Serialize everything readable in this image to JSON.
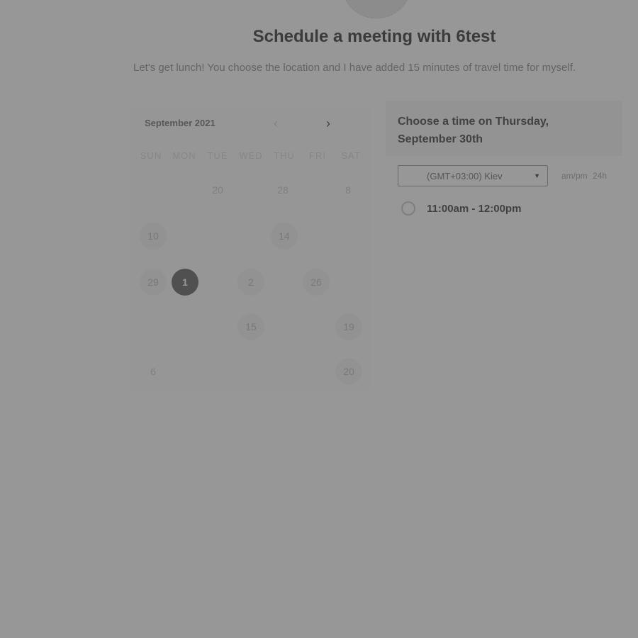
{
  "header": {
    "title": "Schedule a meeting with 6test",
    "subtitle": "Let's get lunch! You choose the location and I have added 15 minutes of travel time for myself."
  },
  "calendar": {
    "month_label": "September 2021",
    "prev_icon": "‹",
    "next_icon": "›",
    "weekdays": [
      "SUN",
      "MON",
      "TUE",
      "WED",
      "THU",
      "FRI",
      "SAT"
    ],
    "days": {
      "d20": "20",
      "d28": "28",
      "d8": "8",
      "d10": "10",
      "d14": "14",
      "d29": "29",
      "d1": "1",
      "d2": "2",
      "d26": "26",
      "d15": "15",
      "d19": "19",
      "d6": "6",
      "d20b": "20"
    }
  },
  "time_panel": {
    "heading": "Choose a time on Thursday, September 30th",
    "timezone": "(GMT+03:00) Kiev",
    "format_ampm": "am/pm",
    "format_24h": "24h",
    "slots": [
      "11:00am - 12:00pm"
    ]
  },
  "colors": {
    "overlay": "#464646",
    "selected_day": "#5f5f5f"
  }
}
